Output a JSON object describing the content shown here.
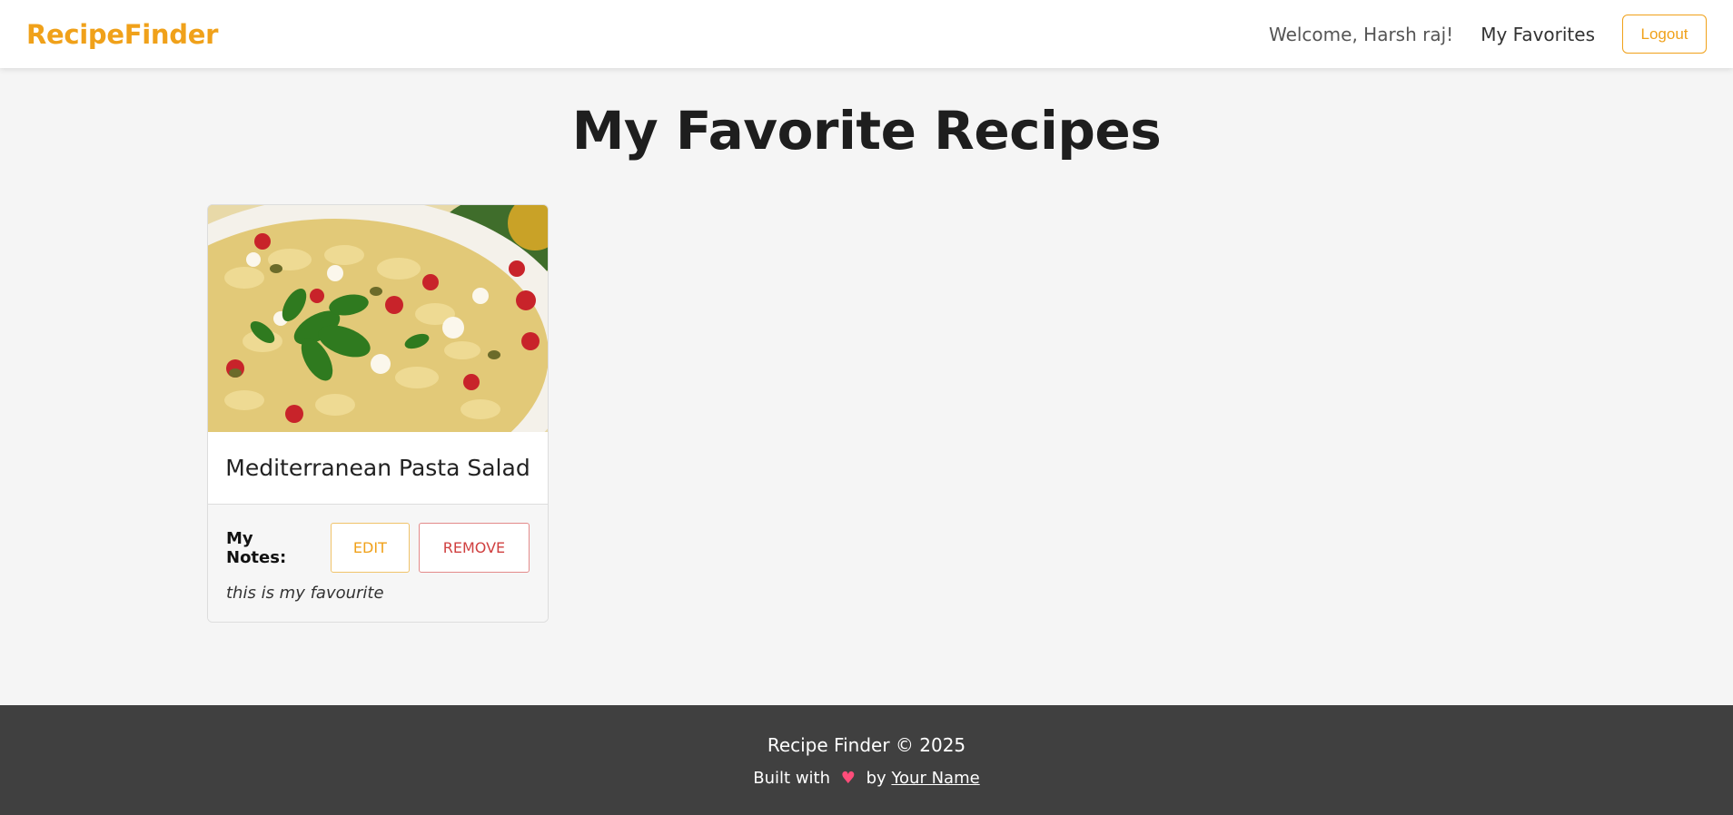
{
  "header": {
    "brand": "RecipeFinder",
    "welcome": "Welcome, Harsh raj!",
    "favorites_link": "My Favorites",
    "logout_label": "Logout"
  },
  "main": {
    "title": "My Favorite Recipes",
    "favorites": [
      {
        "title": "Mediterranean Pasta Salad",
        "notes_label": "My Notes:",
        "edit_label": "EDIT",
        "remove_label": "REMOVE",
        "note": "this is my favourite"
      }
    ]
  },
  "footer": {
    "copyright": "Recipe Finder © 2025",
    "built_with": "Built with",
    "heart": "♥",
    "by": "by",
    "author_link": "Your Name"
  },
  "colors": {
    "accent": "#f0a11a",
    "danger": "#d04040",
    "footer_bg": "#404040",
    "page_bg": "#f5f5f5"
  }
}
